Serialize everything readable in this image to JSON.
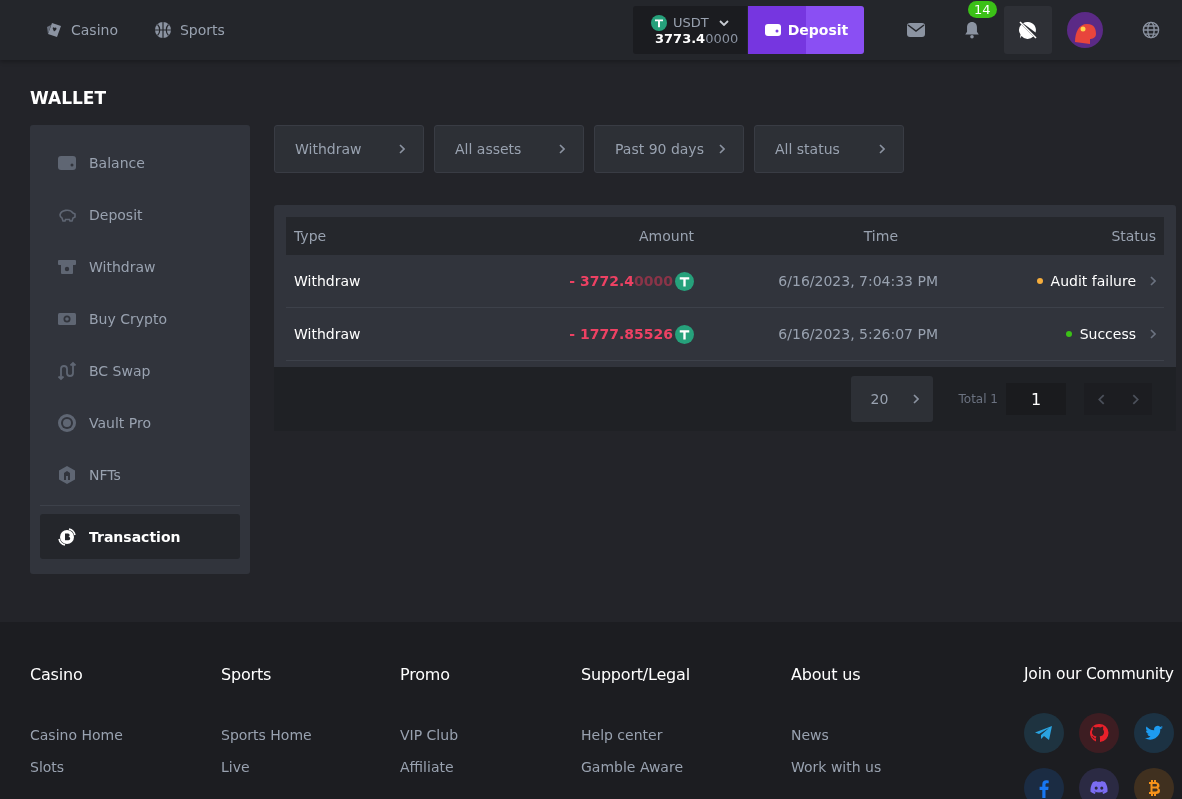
{
  "header": {
    "nav": [
      {
        "label": "Casino"
      },
      {
        "label": "Sports"
      }
    ],
    "balance": {
      "currency": "USDT",
      "amount": "3773.4",
      "trailing": "0000"
    },
    "deposit_button": "Deposit",
    "notifications": {
      "count": "14"
    }
  },
  "page_title": "WALLET",
  "sidebar": {
    "items": [
      {
        "label": "Balance",
        "selected": false
      },
      {
        "label": "Deposit",
        "selected": false
      },
      {
        "label": "Withdraw",
        "selected": false
      },
      {
        "label": "Buy Crypto",
        "selected": false
      },
      {
        "label": "BC Swap",
        "selected": false
      },
      {
        "label": "Vault Pro",
        "selected": false
      },
      {
        "label": "NFTs",
        "selected": false
      },
      {
        "label": "Transaction",
        "selected": true
      }
    ]
  },
  "filters": [
    "Withdraw",
    "All assets",
    "Past 90 days",
    "All status"
  ],
  "table": {
    "columns": [
      "Type",
      "Amount",
      "Time",
      "Status"
    ],
    "rows": [
      {
        "type": "Withdraw",
        "amount": "- 3772.4",
        "trailing": "0000",
        "time": "6/16/2023, 7:04:33 PM",
        "status": "Audit failure",
        "color": "#f6ad3c"
      },
      {
        "type": "Withdraw",
        "amount": "- 1777.85526",
        "trailing": "",
        "time": "6/16/2023, 5:26:07 PM",
        "status": "Success",
        "color": "#3bc117"
      }
    ]
  },
  "pagination": {
    "page_size": "20",
    "total": "Total 1",
    "page": "1"
  },
  "footer": {
    "columns": [
      {
        "title": "Casino",
        "links": [
          "Casino Home",
          "Slots"
        ]
      },
      {
        "title": "Sports",
        "links": [
          "Sports Home",
          "Live"
        ]
      },
      {
        "title": "Promo",
        "links": [
          "VIP Club",
          "Affiliate"
        ]
      },
      {
        "title": "Support/Legal",
        "links": [
          "Help center",
          "Gamble Aware"
        ]
      },
      {
        "title": "About us",
        "links": [
          "News",
          "Work with us"
        ]
      }
    ],
    "community": {
      "title": "Join our Community",
      "icons": [
        {
          "kind": "telegram",
          "color": "#2aa3e0"
        },
        {
          "kind": "github",
          "color": "#e8202a"
        },
        {
          "kind": "twitter",
          "color": "#1d9bf0"
        },
        {
          "kind": "facebook",
          "color": "#1877f2"
        },
        {
          "kind": "discord",
          "color": "#7a6cf2"
        },
        {
          "kind": "bitcoin",
          "color": "#f7931a"
        }
      ]
    }
  }
}
